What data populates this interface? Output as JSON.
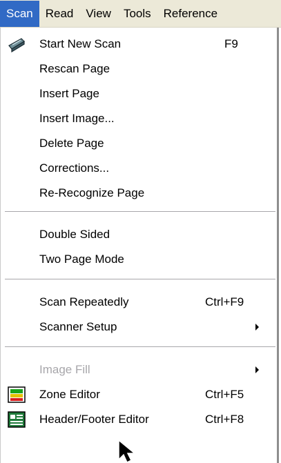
{
  "menubar": {
    "items": [
      {
        "label": "Scan",
        "active": true
      },
      {
        "label": "Read"
      },
      {
        "label": "View"
      },
      {
        "label": "Tools"
      },
      {
        "label": "Reference"
      }
    ]
  },
  "menu": {
    "start_new_scan": {
      "label": "Start New Scan",
      "shortcut": "F9",
      "icon": "scanner-icon"
    },
    "rescan_page": {
      "label": "Rescan Page"
    },
    "insert_page": {
      "label": "Insert Page"
    },
    "insert_image": {
      "label": "Insert Image..."
    },
    "delete_page": {
      "label": "Delete Page"
    },
    "corrections": {
      "label": "Corrections..."
    },
    "re_recognize_page": {
      "label": "Re-Recognize Page"
    },
    "double_sided": {
      "label": "Double Sided"
    },
    "two_page_mode": {
      "label": "Two Page Mode"
    },
    "scan_repeatedly": {
      "label": "Scan Repeatedly",
      "shortcut": "Ctrl+F9"
    },
    "scanner_setup": {
      "label": "Scanner Setup",
      "submenu": true
    },
    "image_fill": {
      "label": "Image Fill",
      "submenu": true,
      "disabled": true
    },
    "zone_editor": {
      "label": "Zone Editor",
      "shortcut": "Ctrl+F5",
      "icon": "zone-editor-icon"
    },
    "header_footer_editor": {
      "label": "Header/Footer Editor",
      "shortcut": "Ctrl+F8",
      "icon": "header-footer-editor-icon"
    }
  },
  "colors": {
    "menubar_bg": "#ece9d8",
    "highlight": "#316ac5",
    "disabled_text": "#a7a6aa"
  }
}
